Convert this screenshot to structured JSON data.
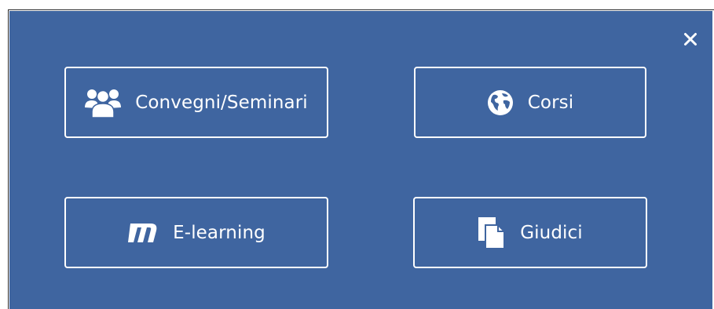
{
  "colors": {
    "panel_background": "#3f65a0",
    "tile_border": "#ffffff",
    "text": "#ffffff"
  },
  "dialog": {
    "close_icon": "close-icon"
  },
  "tiles": [
    {
      "label": "Convegni/Seminari",
      "icon": "users-group-icon"
    },
    {
      "label": "Corsi",
      "icon": "globe-icon"
    },
    {
      "label": "E-learning",
      "icon": "m-logo-icon"
    },
    {
      "label": "Giudici",
      "icon": "documents-icon"
    }
  ]
}
